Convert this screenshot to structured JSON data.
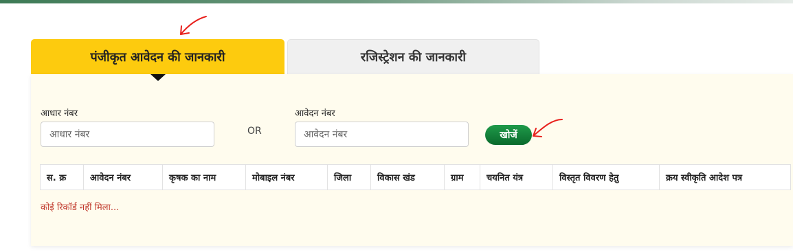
{
  "tabs": {
    "active_label": "पंजीकृत आवेदन की जानकारी",
    "inactive_label": "रजिस्ट्रेशन की जानकारी"
  },
  "form": {
    "aadhaar_label": "आधार नंबर",
    "aadhaar_placeholder": "आधार नंबर",
    "or_text": "OR",
    "application_label": "आवेदन नंबर",
    "application_placeholder": "आवेदन नंबर",
    "search_button": "खोजें"
  },
  "table": {
    "columns": [
      "स. क्र",
      "आवेदन नंबर",
      "कृषक का नाम",
      "मोबाइल नंबर",
      "जिला",
      "विकास खंड",
      "ग्राम",
      "चयनित यंत्र",
      "विस्तृत विवरण हेतु",
      "क्रय स्वीकृति आदेश पत्र"
    ],
    "empty_message": "कोई रिकॉर्ड नहीं मिला..."
  },
  "colors": {
    "active_tab": "#fdcb0e",
    "panel_bg": "#fffcee",
    "button_green": "#0a6a2c",
    "error_text": "#c0392b",
    "annotation_red": "#e8201c"
  }
}
